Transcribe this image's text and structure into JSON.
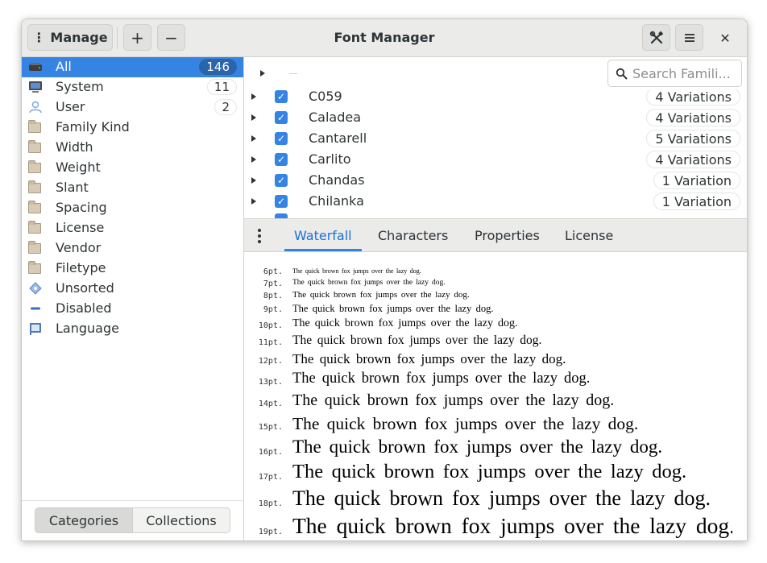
{
  "window": {
    "title": "Font Manager"
  },
  "header": {
    "manage_label": "Manage",
    "add_symbol": "+",
    "remove_symbol": "−",
    "close_symbol": "✕"
  },
  "sidebar": {
    "categories": [
      {
        "label": "All",
        "count": "146",
        "icon": "drive-icon"
      },
      {
        "label": "System",
        "count": "11",
        "icon": "computer-icon"
      },
      {
        "label": "User",
        "count": "2",
        "icon": "user-icon"
      },
      {
        "label": "Family Kind",
        "icon": "folder-icon"
      },
      {
        "label": "Width",
        "icon": "folder-icon"
      },
      {
        "label": "Weight",
        "icon": "folder-icon"
      },
      {
        "label": "Slant",
        "icon": "folder-icon"
      },
      {
        "label": "Spacing",
        "icon": "folder-icon"
      },
      {
        "label": "License",
        "icon": "folder-icon"
      },
      {
        "label": "Vendor",
        "icon": "folder-icon"
      },
      {
        "label": "Filetype",
        "icon": "folder-icon"
      },
      {
        "label": "Unsorted",
        "icon": "unsorted-icon"
      },
      {
        "label": "Disabled",
        "icon": "disabled-icon"
      },
      {
        "label": "Language",
        "icon": "language-icon"
      }
    ],
    "switcher": {
      "categories_label": "Categories",
      "collections_label": "Collections"
    }
  },
  "search": {
    "placeholder": "Search Famili..."
  },
  "font_list": [
    {
      "name": "C059",
      "variations": "4 Variations"
    },
    {
      "name": "Caladea",
      "variations": "4 Variations"
    },
    {
      "name": "Cantarell",
      "variations": "5 Variations"
    },
    {
      "name": "Carlito",
      "variations": "4 Variations"
    },
    {
      "name": "Chandas",
      "variations": "1 Variation"
    },
    {
      "name": "Chilanka",
      "variations": "1 Variation"
    }
  ],
  "tabs": [
    "Waterfall",
    "Characters",
    "Properties",
    "License"
  ],
  "waterfall": {
    "sample": "The quick brown fox jumps over the lazy dog.",
    "sizes": [
      "6pt.",
      "7pt.",
      "8pt.",
      "9pt.",
      "10pt.",
      "11pt.",
      "12pt.",
      "13pt.",
      "14pt.",
      "15pt.",
      "16pt.",
      "17pt.",
      "18pt.",
      "19pt."
    ]
  },
  "colors": {
    "accent": "#3584e4",
    "selected_badge": "#2a64ab",
    "header": "#ebebea"
  }
}
